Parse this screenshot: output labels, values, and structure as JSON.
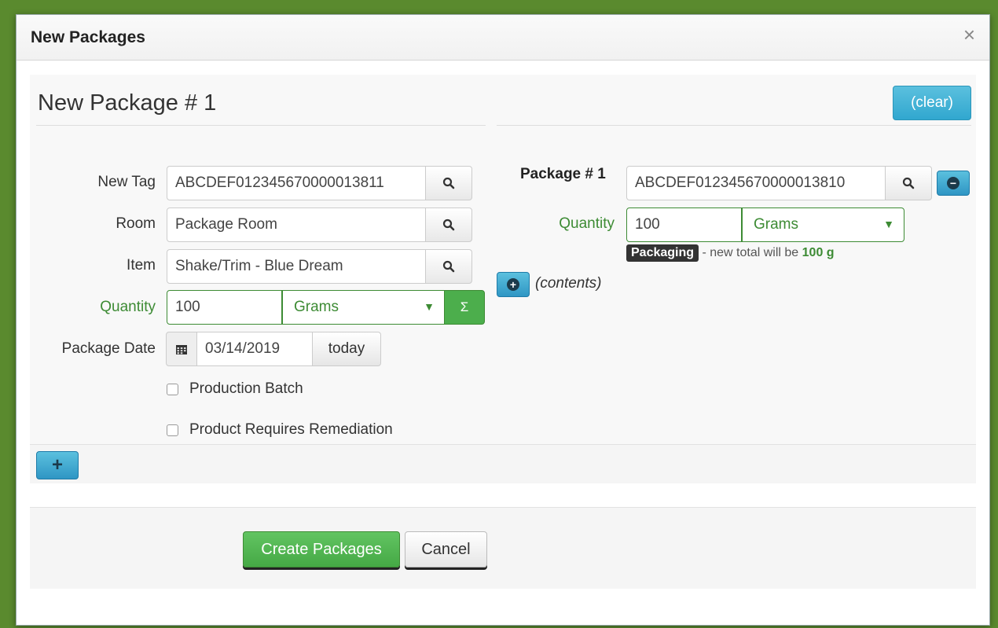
{
  "modal": {
    "title": "New Packages",
    "close_glyph": "×"
  },
  "package": {
    "title": "New Package # 1",
    "clear_label": "(clear)"
  },
  "form": {
    "new_tag_label": "New Tag",
    "new_tag_value": "ABCDEF012345670000013811",
    "room_label": "Room",
    "room_value": "Package Room",
    "item_label": "Item",
    "item_value": "Shake/Trim - Blue Dream",
    "quantity_label": "Quantity",
    "quantity_value": "100",
    "unit_value": "Grams",
    "sigma_glyph": "Σ",
    "package_date_label": "Package Date",
    "package_date_value": "03/14/2019",
    "today_label": "today",
    "production_batch_label": "Production Batch",
    "remediation_label": "Product Requires Remediation"
  },
  "source": {
    "package_label": "Package # 1",
    "package_tag_value": "ABCDEF012345670000013810",
    "quantity_label": "Quantity",
    "quantity_value": "100",
    "unit_value": "Grams",
    "badge_text": "Packaging",
    "note_text": " - new total will be ",
    "note_total": "100 g",
    "contents_label": "(contents)"
  },
  "footer": {
    "add_glyph": "+",
    "create_label": "Create Packages",
    "cancel_label": "Cancel"
  },
  "colors": {
    "accent_green": "#3d8b34",
    "accent_blue": "#5bc0de",
    "background_green": "#5a8a2e"
  }
}
